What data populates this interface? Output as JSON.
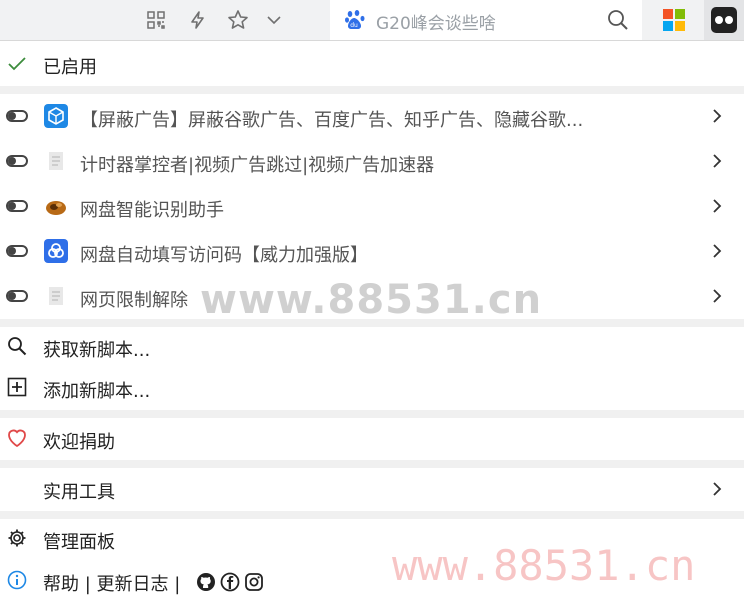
{
  "toolbar": {
    "icons": [
      "qr-code-icon",
      "lightning-icon",
      "star-icon",
      "chevron-down-icon"
    ],
    "search": {
      "engine_icon": "baidu-paw-icon",
      "text": "G20峰会谈些啥",
      "search_icon": "magnifier-icon"
    },
    "extensions": [
      "microsoft-logo-icon",
      "tampermonkey-icon"
    ]
  },
  "menu": {
    "enabled_label": "已启用",
    "scripts": [
      {
        "name": "【屏蔽广告】屏蔽谷歌广告、百度广告、知乎广告、隐藏谷歌...",
        "icon": "cube-blue-icon",
        "enabled": false
      },
      {
        "name": "计时器掌控者|视频广告跳过|视频广告加速器",
        "icon": "document-icon",
        "enabled": false
      },
      {
        "name": "网盘智能识别助手",
        "icon": "acorn-icon",
        "enabled": false
      },
      {
        "name": "网盘自动填写访问码【威力加强版】",
        "icon": "baidu-cloud-icon",
        "enabled": false
      },
      {
        "name": "网页限制解除",
        "icon": "document-icon",
        "enabled": false
      }
    ],
    "get_new_script": "获取新脚本...",
    "add_new_script": "添加新脚本...",
    "donate": "欢迎捐助",
    "utilities": "实用工具",
    "dashboard": "管理面板",
    "help_line": "帮助 | 更新日志 |"
  },
  "watermark": {
    "top": "www.88531.cn",
    "bottom": "www.88531.cn"
  },
  "colors": {
    "check": "#3c8c3c",
    "heart": "#e04848",
    "accent_blue": "#1e88e5"
  }
}
